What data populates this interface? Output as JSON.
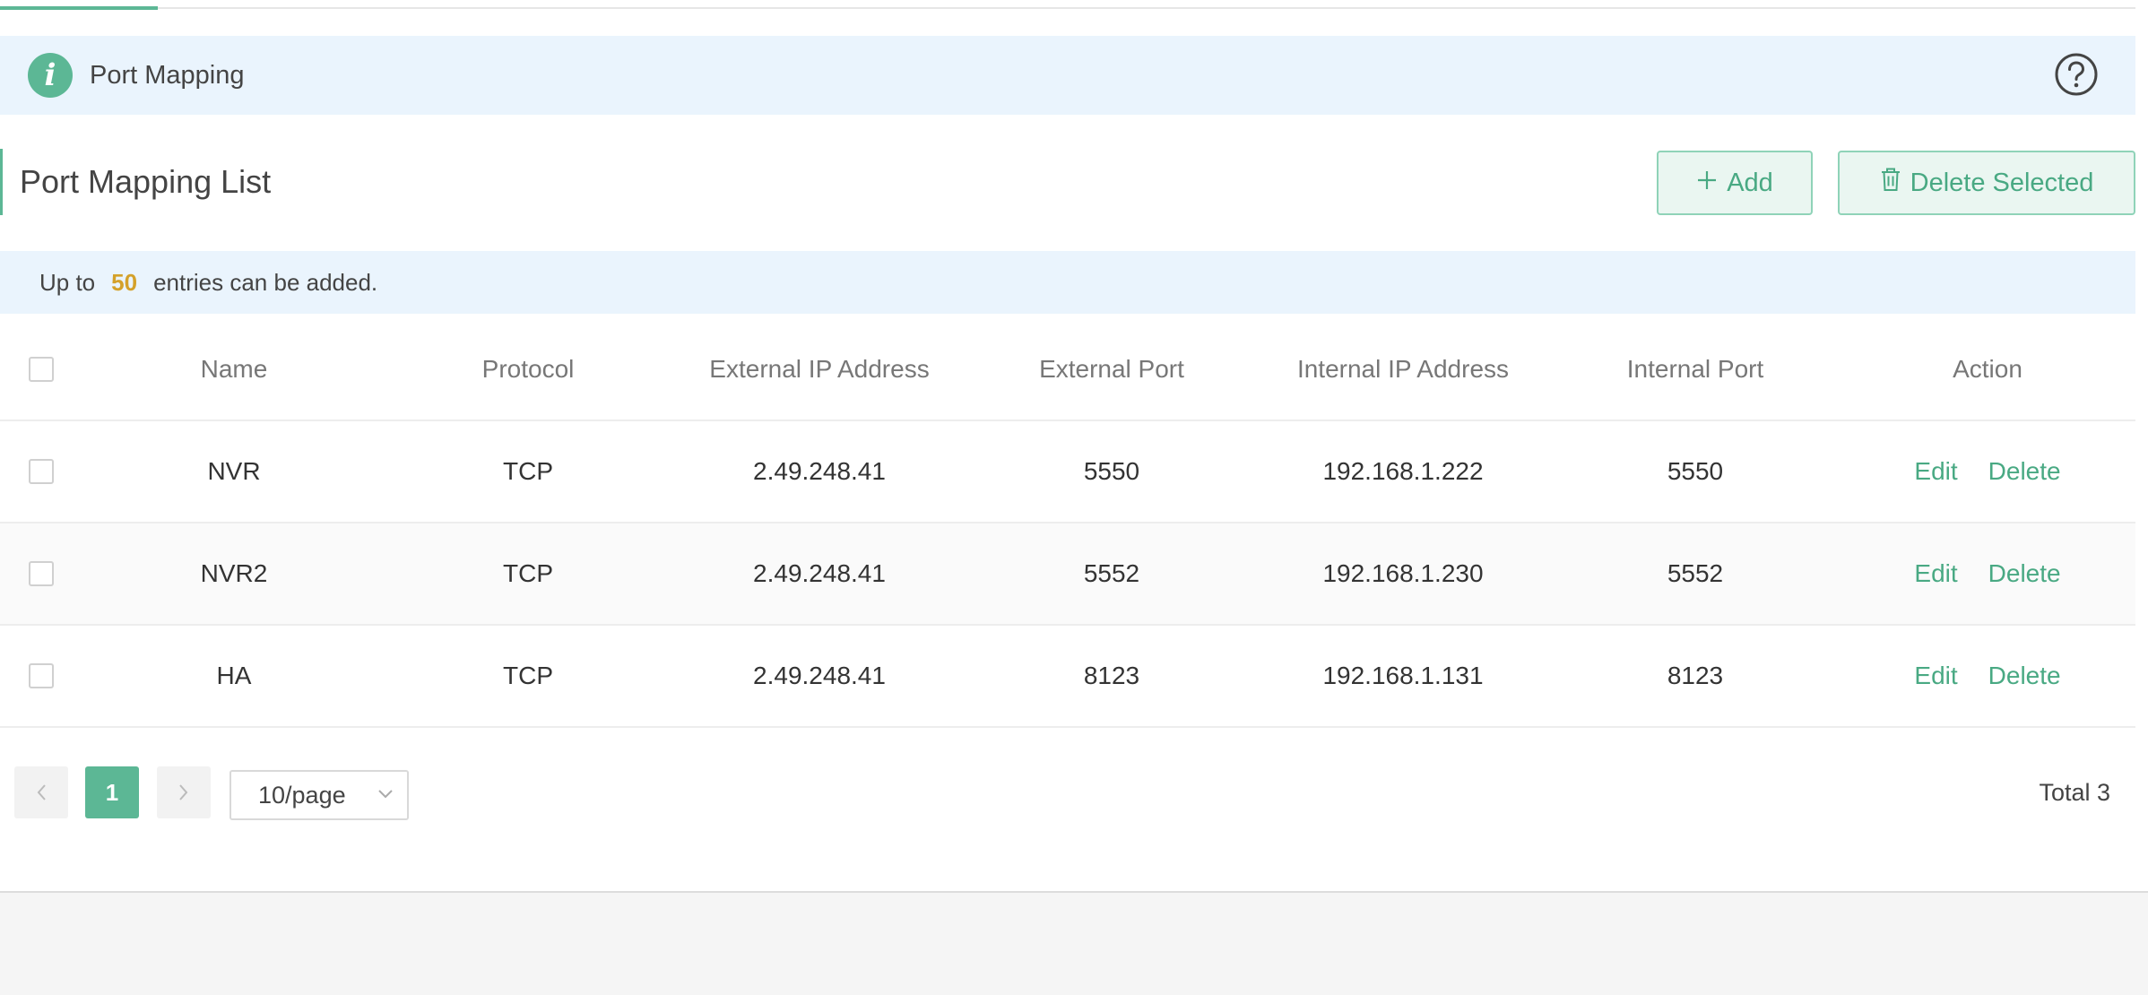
{
  "header": {
    "title": "Port Mapping"
  },
  "list": {
    "title": "Port Mapping List",
    "add_label": "Add",
    "delete_selected_label": "Delete Selected"
  },
  "notice": {
    "prefix": "Up to",
    "max_entries": "50",
    "suffix": "entries can be added."
  },
  "table": {
    "columns": [
      "Name",
      "Protocol",
      "External IP Address",
      "External Port",
      "Internal IP Address",
      "Internal Port",
      "Action"
    ],
    "rows": [
      {
        "name": "NVR",
        "protocol": "TCP",
        "ext_ip": "2.49.248.41",
        "ext_port": "5550",
        "int_ip": "192.168.1.222",
        "int_port": "5550"
      },
      {
        "name": "NVR2",
        "protocol": "TCP",
        "ext_ip": "2.49.248.41",
        "ext_port": "5552",
        "int_ip": "192.168.1.230",
        "int_port": "5552"
      },
      {
        "name": "HA",
        "protocol": "TCP",
        "ext_ip": "2.49.248.41",
        "ext_port": "8123",
        "int_ip": "192.168.1.131",
        "int_port": "8123"
      }
    ],
    "edit_label": "Edit",
    "delete_label": "Delete"
  },
  "pagination": {
    "current_page": "1",
    "page_size": "10/page",
    "total_label": "Total 3"
  },
  "colors": {
    "accent": "#5cb795",
    "link": "#49a983",
    "notice_bg": "#eaf4fd",
    "highlight": "#d4a12a"
  },
  "icons": {
    "info": "info-icon",
    "help": "help-icon",
    "add": "plus-icon",
    "delete": "trash-icon",
    "prev": "chevron-left-icon",
    "next": "chevron-right-icon",
    "dropdown": "chevron-down-icon"
  }
}
